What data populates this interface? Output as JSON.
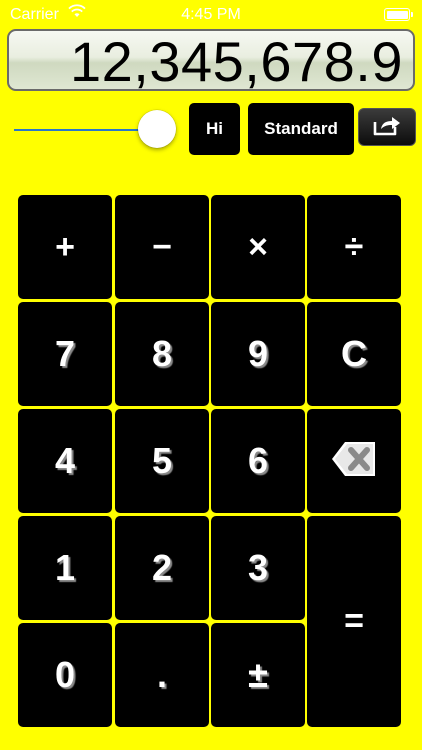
{
  "status_bar": {
    "carrier": "Carrier",
    "time": "4:45 PM",
    "icons": [
      "wifi-icon",
      "battery-icon"
    ]
  },
  "display": {
    "value": "12,345,678.9"
  },
  "controls": {
    "slider_value_fraction": 0.95,
    "precision_label": "Hi",
    "mode_label": "Standard",
    "share_icon": "share-icon"
  },
  "keypad": {
    "plus": "+",
    "minus": "−",
    "multiply": "×",
    "divide": "÷",
    "seven": "7",
    "eight": "8",
    "nine": "9",
    "clear": "C",
    "four": "4",
    "five": "5",
    "six": "6",
    "backspace_icon": "backspace-icon",
    "one": "1",
    "two": "2",
    "three": "3",
    "equals": "=",
    "zero": "0",
    "decimal": ".",
    "sign": "±"
  },
  "colors": {
    "background": "#ffff00",
    "key_background": "#000000",
    "key_text": "#ffffff",
    "slider_track": "#2a77c9"
  }
}
